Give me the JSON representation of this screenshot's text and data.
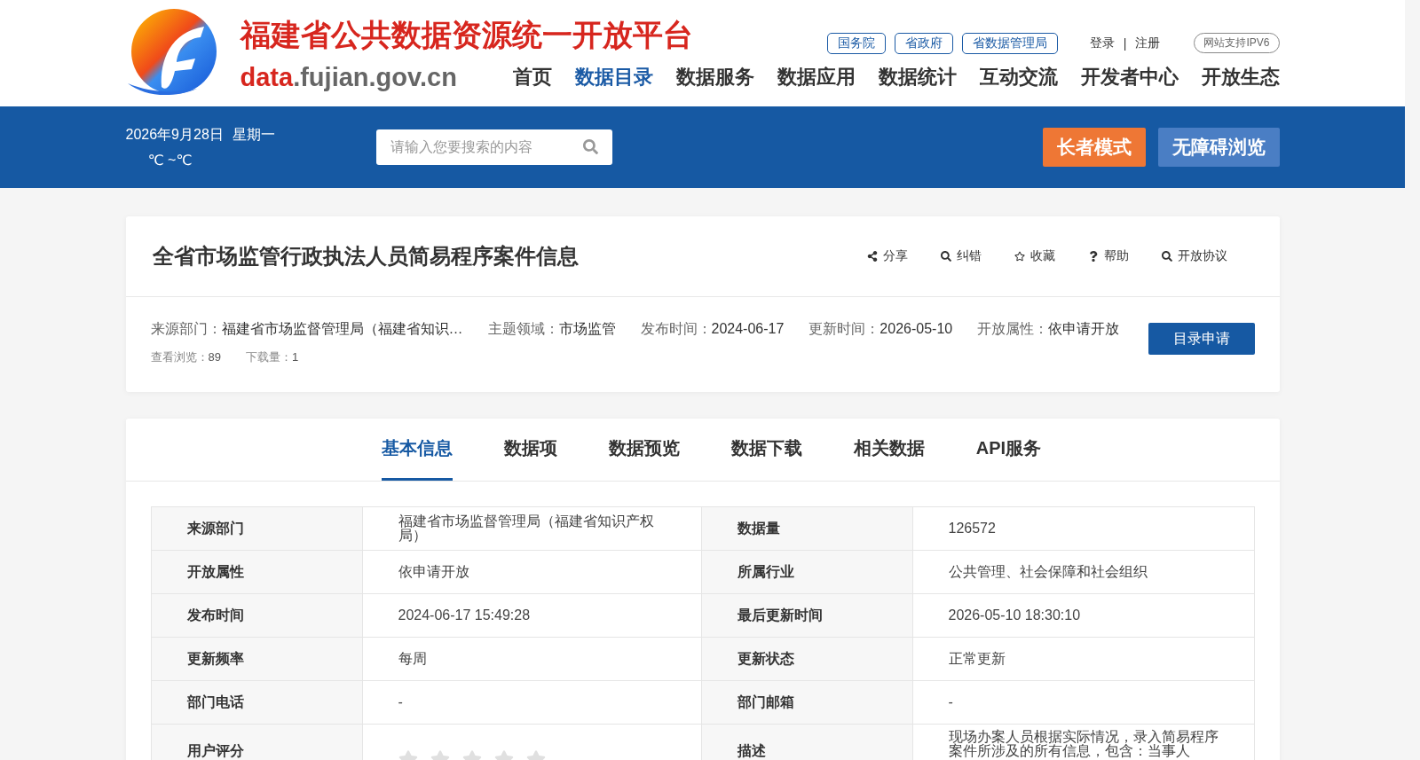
{
  "header": {
    "site_title": "福建省公共数据资源统一开放平台",
    "domain": {
      "highlight": "data",
      "rest": ".fujian.gov.cn"
    },
    "top_links": [
      "国务院",
      "省政府",
      "省数据管理局"
    ],
    "auth": {
      "login": "登录",
      "separator": "|",
      "register": "注册"
    },
    "ipv6_badge": "网站支持IPV6",
    "nav": [
      {
        "label": "首页",
        "selected": false
      },
      {
        "label": "数据目录",
        "selected": true
      },
      {
        "label": "数据服务",
        "selected": false
      },
      {
        "label": "数据应用",
        "selected": false
      },
      {
        "label": "数据统计",
        "selected": false
      },
      {
        "label": "互动交流",
        "selected": false
      },
      {
        "label": "开发者中心",
        "selected": false
      },
      {
        "label": "开放生态",
        "selected": false
      }
    ]
  },
  "info_bar": {
    "date": "2026年9月28日",
    "weekday": "星期一",
    "temperature": "℃ ~℃",
    "search": {
      "placeholder": "请输入您要搜索的内容"
    },
    "buttons": [
      {
        "label": "长者模式",
        "kind": "elder"
      },
      {
        "label": "无障碍浏览",
        "kind": "accessible"
      }
    ]
  },
  "dataset": {
    "title": "全省市场监管行政执法人员简易程序案件信息",
    "actions": [
      {
        "label": "分享",
        "kind": "share"
      },
      {
        "label": "纠错",
        "kind": "search"
      },
      {
        "label": "收藏",
        "kind": "star"
      },
      {
        "label": "帮助",
        "kind": "help"
      },
      {
        "label": "开放协议",
        "kind": "search"
      }
    ],
    "meta": [
      {
        "label": "来源部门：",
        "value": "福建省市场监督管理局（福建省知识…"
      },
      {
        "label": "主题领域：",
        "value": "市场监管"
      },
      {
        "label": "发布时间：",
        "value": "2024-06-17"
      },
      {
        "label": "更新时间：",
        "value": "2026-05-10"
      },
      {
        "label": "开放属性：",
        "value": "依申请开放"
      }
    ],
    "stats": [
      {
        "label": "查看浏览：",
        "value": "89"
      },
      {
        "label": "下载量：",
        "value": "1"
      }
    ],
    "apply_button": "目录申请"
  },
  "tabs": [
    {
      "label": "基本信息",
      "selected": true
    },
    {
      "label": "数据项",
      "selected": false
    },
    {
      "label": "数据预览",
      "selected": false
    },
    {
      "label": "数据下载",
      "selected": false
    },
    {
      "label": "相关数据",
      "selected": false
    },
    {
      "label": "API服务",
      "selected": false
    }
  ],
  "info_table": {
    "rows": [
      {
        "cells": [
          {
            "label": "来源部门",
            "value": "福建省市场监督管理局（福建省知识产权局）"
          },
          {
            "label": "数据量",
            "value": "126572"
          }
        ]
      },
      {
        "cells": [
          {
            "label": "开放属性",
            "value": "依申请开放"
          },
          {
            "label": "所属行业",
            "value": "公共管理、社会保障和社会组织"
          }
        ]
      },
      {
        "cells": [
          {
            "label": "发布时间",
            "value": "2024-06-17 15:49:28"
          },
          {
            "label": "最后更新时间",
            "value": "2026-05-10 18:30:10"
          }
        ]
      },
      {
        "cells": [
          {
            "label": "更新频率",
            "value": "每周"
          },
          {
            "label": "更新状态",
            "value": "正常更新"
          }
        ]
      },
      {
        "cells": [
          {
            "label": "部门电话",
            "value": "-"
          },
          {
            "label": "部门邮箱",
            "value": "-"
          }
        ]
      },
      {
        "cells": [
          {
            "label": "用户评分",
            "kind": "rating",
            "stars": 0
          },
          {
            "label": "描述",
            "value": "现场办案人员根据实际情况，录入简易程序案件所涉及的所有信息，包含：当事人"
          }
        ]
      }
    ]
  }
}
